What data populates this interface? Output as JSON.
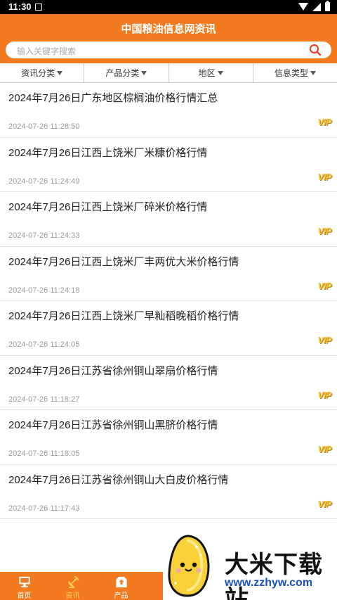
{
  "status_bar": {
    "time": "11:30"
  },
  "header": {
    "title": "中国粮油信息网资讯",
    "search_placeholder": "输入关键字搜索"
  },
  "filters": [
    {
      "label": "资讯分类"
    },
    {
      "label": "产品分类"
    },
    {
      "label": "地区"
    },
    {
      "label": "信息类型"
    }
  ],
  "news": [
    {
      "title": "2024年7月26日广东地区棕榈油价格行情汇总",
      "time": "2024-07-26 11:28:50",
      "badge": "VIP"
    },
    {
      "title": "2024年7月26日江西上饶米厂米糠价格行情",
      "time": "2024-07-26 11:24:49",
      "badge": "VIP"
    },
    {
      "title": "2024年7月26日江西上饶米厂碎米价格行情",
      "time": "2024-07-26 11:24:33",
      "badge": "VIP"
    },
    {
      "title": "2024年7月26日江西上饶米厂丰两优大米价格行情",
      "time": "2024-07-26 11:24:18",
      "badge": "VIP"
    },
    {
      "title": "2024年7月26日江西上饶米厂早籼稻晚稻价格行情",
      "time": "2024-07-26 11:24:05",
      "badge": "VIP"
    },
    {
      "title": "2024年7月26日江苏省徐州铜山翠扇价格行情",
      "time": "2024-07-26 11:18:27",
      "badge": "VIP"
    },
    {
      "title": "2024年7月26日江苏省徐州铜山黑脐价格行情",
      "time": "2024-07-26 11:18:05",
      "badge": "VIP"
    },
    {
      "title": "2024年7月26日江苏省徐州铜山大白皮价格行情",
      "time": "2024-07-26 11:17:43",
      "badge": "VIP"
    }
  ],
  "tabs": [
    {
      "label": "首页",
      "icon": "monitor-icon"
    },
    {
      "label": "资讯",
      "icon": "satellite-dish-icon"
    },
    {
      "label": "产品",
      "icon": "upload-box-icon"
    }
  ],
  "watermark": {
    "title": "大米下载站",
    "url": "www.zzhyw.com"
  },
  "colors": {
    "brand_orange": "#f47a1f",
    "active_tab": "#ffd54f",
    "vip_gold": "#f6c243",
    "search_icon_red": "#e8452c"
  }
}
